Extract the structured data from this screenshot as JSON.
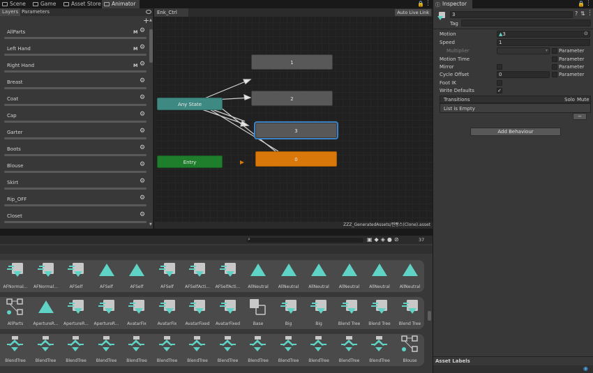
{
  "tabs": [
    {
      "label": "Scene",
      "icon": "scene-icon"
    },
    {
      "label": "Game",
      "icon": "game-icon"
    },
    {
      "label": "Asset Store",
      "icon": "store-icon"
    },
    {
      "label": "Animator",
      "icon": "animator-icon"
    }
  ],
  "layers_panel": {
    "tabs": [
      "Layers",
      "Parameters"
    ],
    "layers": [
      {
        "name": "AllParts",
        "m": "M"
      },
      {
        "name": "Left Hand",
        "m": "M"
      },
      {
        "name": "Right Hand",
        "m": "M"
      },
      {
        "name": "Breast",
        "m": ""
      },
      {
        "name": "Coat",
        "m": ""
      },
      {
        "name": "Cap",
        "m": ""
      },
      {
        "name": "Garter",
        "m": ""
      },
      {
        "name": "Boots",
        "m": ""
      },
      {
        "name": "Blouse",
        "m": ""
      },
      {
        "name": "Skirt",
        "m": ""
      },
      {
        "name": "Rip_OFF",
        "m": ""
      },
      {
        "name": "Closet",
        "m": ""
      }
    ]
  },
  "graph": {
    "breadcrumb": "Enk_Ctrl",
    "live_link": "Auto Live Link",
    "path": "ZZZ_GeneratedAssets/찐빵스(Clone).asset",
    "nodes": {
      "n1": "1",
      "n2": "2",
      "n3": "3",
      "n0": "0",
      "any": "Any State",
      "entry": "Entry"
    }
  },
  "inspector": {
    "tab": "Inspector",
    "name": "3",
    "tag_label": "Tag",
    "motion_label": "Motion",
    "motion_value": "3",
    "speed_label": "Speed",
    "speed_value": "1",
    "multiplier_label": "Multiplier",
    "motion_time_label": "Motion Time",
    "mirror_label": "Mirror",
    "cycle_offset_label": "Cycle Offset",
    "cycle_offset_value": "0",
    "foot_ik_label": "Foot IK",
    "write_defaults_label": "Write Defaults",
    "parameter_label": "Parameter",
    "transitions_label": "Transitions",
    "solo_label": "Solo",
    "mute_label": "Mute",
    "list_empty": "List is Empty",
    "minus": "−",
    "add_behaviour": "Add Behaviour",
    "asset_labels": "Asset Labels"
  },
  "asset_browser": {
    "count": "37",
    "rows": [
      [
        "AFNormal...",
        "AFNormal...",
        "AFSelf",
        "AFSelf",
        "AFSelf",
        "AFSelf",
        "AFSelfActi...",
        "AFSelfActi...",
        "AllNeutral",
        "AllNeutral",
        "AllNeutral",
        "AllNeutral",
        "AllNeutral",
        "AllNeutral"
      ],
      [
        "AllParts",
        "ApertureR...",
        "ApertureR...",
        "ApertureR...",
        "AvatarFix",
        "AvatarFix",
        "AvatarFixed",
        "AvatarFixed",
        "Base",
        "Big",
        "Big",
        "Blend Tree",
        "Blend Tree",
        "Blend Tree"
      ],
      [
        "BlendTree",
        "BlendTree",
        "BlendTree",
        "BlendTree",
        "BlendTree",
        "BlendTree",
        "BlendTree",
        "BlendTree",
        "BlendTree",
        "BlendTree",
        "BlendTree",
        "BlendTree",
        "BlendTree",
        "Blouse"
      ]
    ],
    "row_icons": [
      [
        "clip",
        "clip",
        "clip",
        "tri",
        "tri",
        "clip",
        "clip",
        "clip",
        "tri",
        "tri",
        "tri",
        "tri",
        "tri",
        "tri"
      ],
      [
        "tree",
        "tri",
        "clip",
        "clip",
        "clip",
        "clip",
        "clip",
        "clip",
        "base",
        "clip",
        "clip",
        "clip",
        "clip",
        "clip"
      ],
      [
        "blend",
        "blend",
        "blend",
        "blend",
        "blend",
        "blend",
        "blend",
        "blend",
        "blend",
        "blend",
        "blend",
        "blend",
        "blend",
        "tree"
      ]
    ]
  }
}
